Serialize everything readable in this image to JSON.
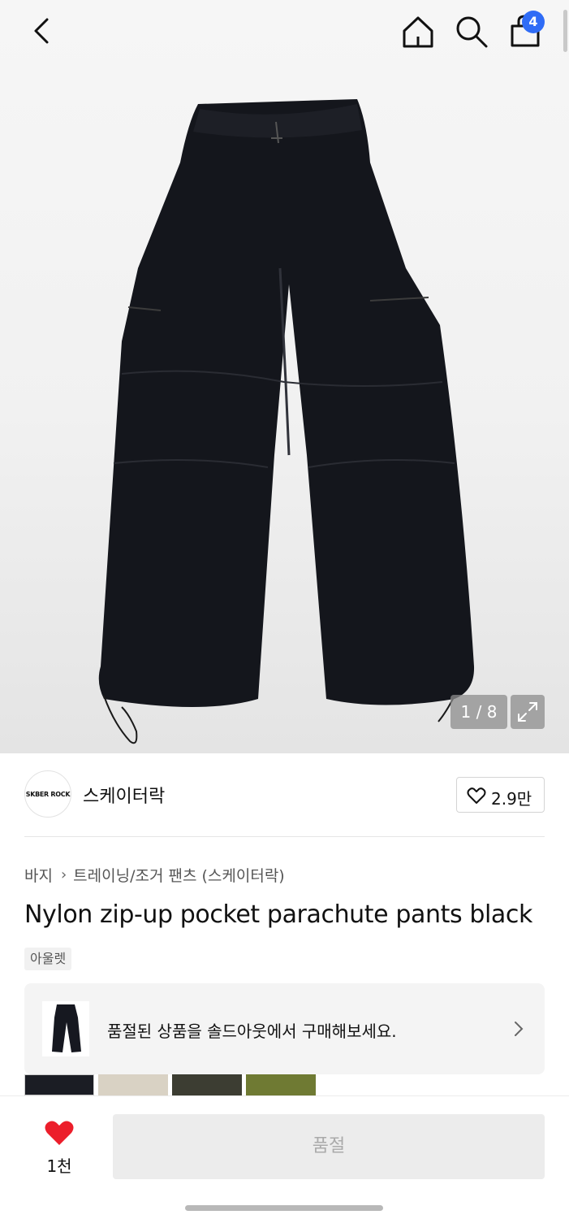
{
  "header": {
    "back_icon": "chevron-left-icon",
    "home_icon": "home-icon",
    "search_icon": "search-icon",
    "cart_icon": "shopping-bag-icon",
    "cart_badge": "4",
    "badge_color": "#2f6cf6"
  },
  "gallery": {
    "counter": "1 / 8",
    "expand_icon": "expand-icon"
  },
  "brand": {
    "logo_text": "SKBER ROCK",
    "name": "스케이터락",
    "like_icon": "heart-outline-icon",
    "like_count": "2.9만"
  },
  "product": {
    "breadcrumb": [
      "바지",
      "트레이닝/조거 팬츠 (스케이터락)"
    ],
    "title": "Nylon zip-up pocket parachute pants black",
    "tag": "아울렛"
  },
  "soldout_banner": {
    "text": "품절된 상품을 솔드아웃에서 구매해보세요."
  },
  "color_options": [
    {
      "color": "#1b1d24"
    },
    {
      "color": "#d9d2c4"
    },
    {
      "color": "#3c3d32"
    },
    {
      "color": "#6f7a33"
    }
  ],
  "bottom_bar": {
    "wish_icon": "heart-filled-icon",
    "wish_color": "#ec1e2b",
    "wish_count": "1천",
    "buy_label": "품절"
  }
}
